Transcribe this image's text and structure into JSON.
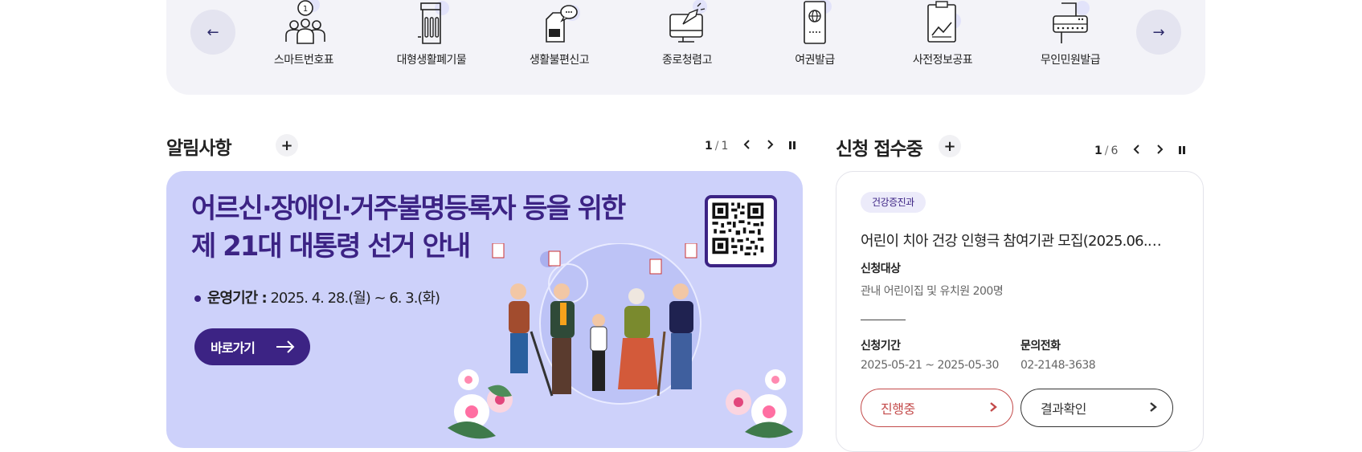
{
  "quick_services": {
    "prev_label": "←",
    "next_label": "→",
    "items": [
      {
        "label": "스마트번호표",
        "icon": "people-number-icon"
      },
      {
        "label": "대형생활폐기물",
        "icon": "trash-bin-icon"
      },
      {
        "label": "생활불편신고",
        "icon": "report-message-icon"
      },
      {
        "label": "종로청렴고",
        "icon": "integrity-report-icon"
      },
      {
        "label": "여권발급",
        "icon": "passport-icon"
      },
      {
        "label": "사전정보공표",
        "icon": "clipboard-chart-icon"
      },
      {
        "label": "무인민원발급",
        "icon": "kiosk-printer-icon"
      }
    ]
  },
  "notice": {
    "title": "알림사항",
    "plus": "+",
    "pager": {
      "current": "1",
      "sep": "/",
      "total": "1"
    },
    "banner": {
      "title_line1": "어르신·장애인·거주불명등록자 등을 위한",
      "title_line2": "제 21대 대통령 선거 안내",
      "period_label": "운영기간 :",
      "period_value": "2025. 4. 28.(월) ~ 6. 3.(화)",
      "button": "바로가기"
    }
  },
  "applications": {
    "title": "신청 접수중",
    "plus": "+",
    "pager": {
      "current": "1",
      "sep": "/",
      "total": "6"
    },
    "card": {
      "tag": "건강증진과",
      "title": "어린이 치아 건강 인형극 참여기관 모집(2025.06.…",
      "target_label": "신청대상",
      "target_value": "관내 어린이집 및 유치원 200명",
      "period_label": "신청기간",
      "period_value": "2025-05-21 ~ 2025-05-30",
      "phone_label": "문의전화",
      "phone_value": "02-2148-3638",
      "status_button": "진행중",
      "result_button": "결과확인"
    }
  },
  "colors": {
    "accent": "#3c2384",
    "banner_bg": "#cdd1fa",
    "strip_bg": "#f3f3f8",
    "status_red": "#c34a4a"
  }
}
